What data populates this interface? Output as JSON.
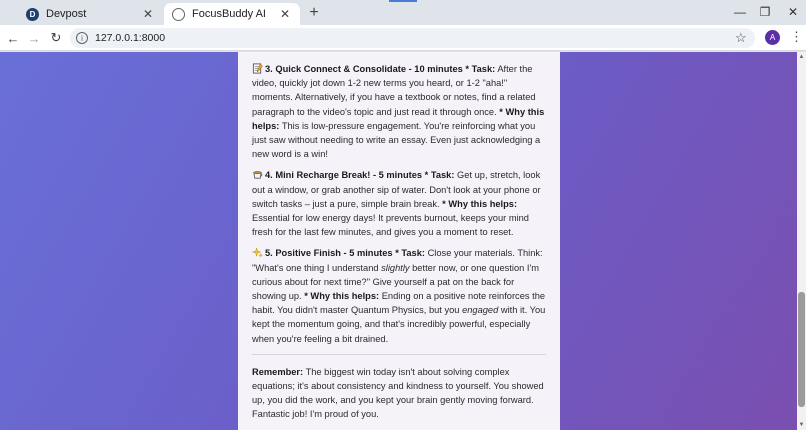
{
  "browser": {
    "tabs": [
      {
        "title": "Devpost",
        "favicon": "devpost-logo-icon"
      },
      {
        "title": "FocusBuddy AI",
        "favicon": "globe-icon"
      }
    ],
    "url": "127.0.0.1:8000",
    "avatar_letter": "A"
  },
  "content": {
    "step3": {
      "heading": "3. Quick Connect & Consolidate - 10 minutes * Task:",
      "task": "After the video, quickly jot down 1-2 new terms you heard, or 1-2 \"aha!\" moments. Alternatively, if you have a textbook or notes, find a related paragraph to the video's topic and just read it through once.",
      "why_label": "* Why this helps:",
      "why": "This is low-pressure engagement. You're reinforcing what you just saw without needing to write an essay. Even just acknowledging a new word is a win!"
    },
    "step4": {
      "heading": "4. Mini Recharge Break! - 5 minutes * Task:",
      "task": "Get up, stretch, look out a window, or grab another sip of water. Don't look at your phone or switch tasks – just a pure, simple brain break.",
      "why_label": "* Why this helps:",
      "why": "Essential for low energy days! It prevents burnout, keeps your mind fresh for the last few minutes, and gives you a moment to reset."
    },
    "step5": {
      "heading": "5. Positive Finish - 5 minutes * Task:",
      "task_a": "Close your materials. Think: \"What's one thing I understand",
      "task_em": "slightly",
      "task_b": "better now, or one question I'm curious about for next time?\" Give yourself a pat on the back for showing up.",
      "why_label": "* Why this helps:",
      "why_a": "Ending on a positive note reinforces the habit. You didn't master Quantum Physics, but you",
      "why_em": "engaged",
      "why_b": "with it. You kept the momentum going, and that's incredibly powerful, especially when you're feeling a bit drained."
    },
    "remember": {
      "label": "Remember:",
      "text": "The biggest win today isn't about solving complex equations; it's about consistency and kindness to yourself. You showed up, you did the work, and you kept your brain gently moving forward. Fantastic job! I'm proud of you."
    }
  }
}
